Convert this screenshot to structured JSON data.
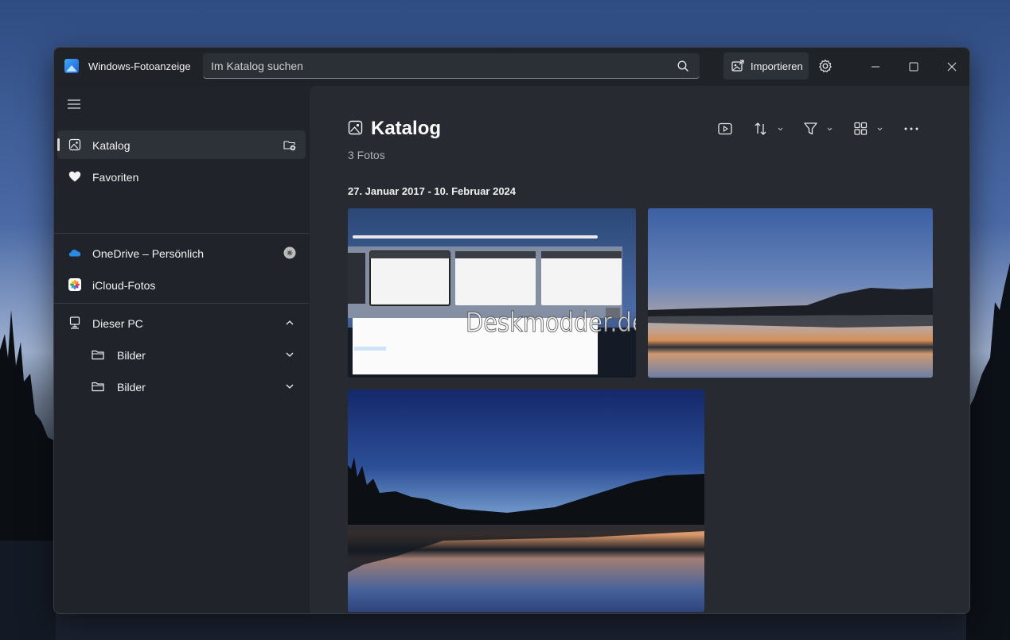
{
  "app": {
    "title": "Windows-Fotoanzeige",
    "accent": "#3fa9f5"
  },
  "search": {
    "placeholder": "Im Katalog suchen"
  },
  "header": {
    "import_label": "Importieren"
  },
  "sidebar": {
    "items": [
      {
        "label": "Katalog",
        "icon": "photo-icon",
        "active": true,
        "trail_icon": "add-folder-icon"
      },
      {
        "label": "Favoriten",
        "icon": "heart-icon"
      },
      {
        "label": "OneDrive – Persönlich",
        "icon": "cloud-icon",
        "trail_icon": "status-icon"
      },
      {
        "label": "iCloud-Fotos",
        "icon": "icloud-photos-icon"
      },
      {
        "label": "Dieser PC",
        "icon": "pc-icon",
        "trail_icon": "chevron-up-icon"
      },
      {
        "label": "Bilder",
        "icon": "folder-icon",
        "trail_icon": "chevron-down-icon"
      },
      {
        "label": "Bilder",
        "icon": "folder-icon",
        "trail_icon": "chevron-down-icon"
      }
    ]
  },
  "main": {
    "title": "Katalog",
    "count": "3 Fotos",
    "date_range": "27. Januar 2017 - 10. Februar 2024",
    "watermark": "Deskmodder.de"
  }
}
